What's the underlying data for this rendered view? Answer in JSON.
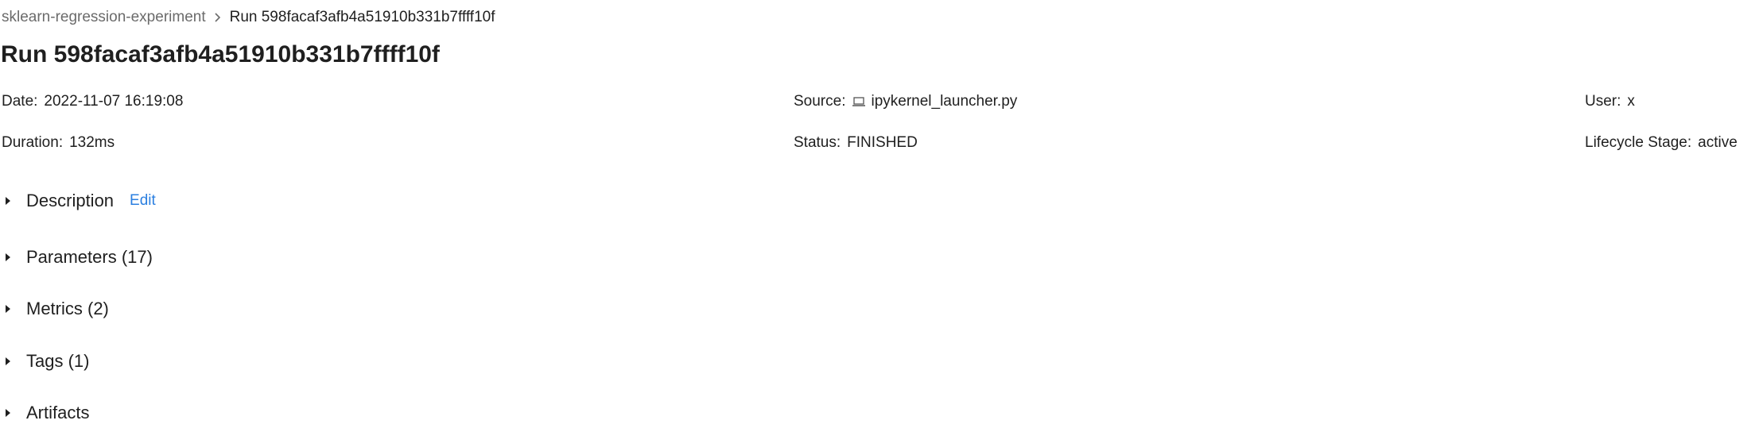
{
  "breadcrumb": {
    "experiment": "sklearn-regression-experiment",
    "current": "Run 598facaf3afb4a51910b331b7ffff10f"
  },
  "title": "Run 598facaf3afb4a51910b331b7ffff10f",
  "meta": {
    "date_label": "Date",
    "date_value": "2022-11-07 16:19:08",
    "source_label": "Source",
    "source_value": "ipykernel_launcher.py",
    "user_label": "User",
    "user_value": "x",
    "duration_label": "Duration",
    "duration_value": "132ms",
    "status_label": "Status",
    "status_value": "FINISHED",
    "lifecycle_label": "Lifecycle Stage",
    "lifecycle_value": "active"
  },
  "sections": {
    "description": "Description",
    "description_edit": "Edit",
    "parameters": "Parameters (17)",
    "metrics": "Metrics (2)",
    "tags": "Tags (1)",
    "artifacts": "Artifacts"
  },
  "colors": {
    "link": "#2b7fe0",
    "muted": "#6b6b6b",
    "text": "#1f1f1f"
  },
  "icons": {
    "breadcrumb_separator": "chevron-right-icon",
    "source": "laptop-icon",
    "section_toggle": "caret-right-icon"
  }
}
